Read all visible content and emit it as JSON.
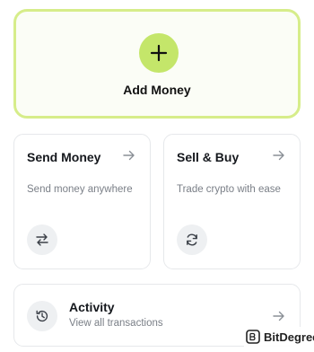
{
  "add_money": {
    "label": "Add Money",
    "icon": "plus-icon",
    "accent_border": "#d6ed8a",
    "accent_fill": "#c4e66a"
  },
  "cards": [
    {
      "title": "Send Money",
      "description": "Send money anywhere",
      "icon": "swap-arrows-icon",
      "arrow_icon": "arrow-right-icon"
    },
    {
      "title": "Sell & Buy",
      "description": "Trade crypto with ease",
      "icon": "refresh-icon",
      "arrow_icon": "arrow-right-icon"
    }
  ],
  "activity": {
    "title": "Activity",
    "subtitle": "View all transactions",
    "icon": "history-icon",
    "arrow_icon": "arrow-right-icon"
  },
  "watermark": {
    "text": "BitDegree",
    "icon": "bitdegree-logo-icon"
  }
}
